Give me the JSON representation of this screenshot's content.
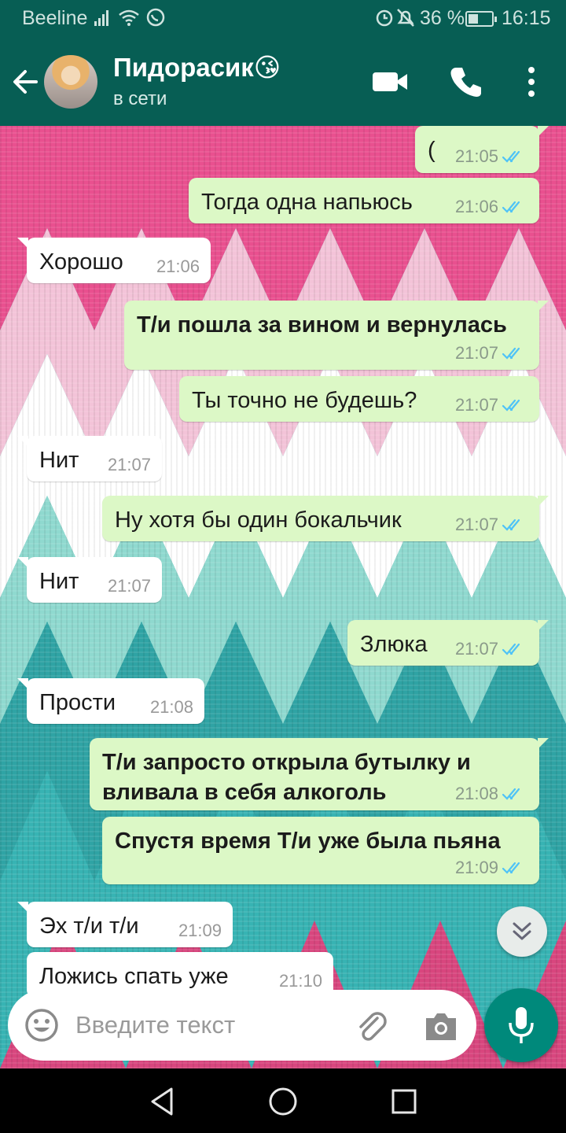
{
  "status_bar": {
    "carrier": "Beeline",
    "battery": "36 %",
    "time": "16:15"
  },
  "header": {
    "contact_name": "Пидорасик😘",
    "contact_status": "в сети"
  },
  "messages": [
    {
      "dir": "out",
      "text": "(",
      "time": "21:05",
      "bold": false
    },
    {
      "dir": "out",
      "text": "Тогда одна напьюсь",
      "time": "21:06",
      "bold": false
    },
    {
      "dir": "in",
      "text": "Хорошо",
      "time": "21:06",
      "bold": false
    },
    {
      "dir": "out",
      "text": "Т/и пошла за вином и вернулась",
      "time": "21:07",
      "bold": true
    },
    {
      "dir": "out",
      "text": "Ты точно не будешь?",
      "time": "21:07",
      "bold": false
    },
    {
      "dir": "in",
      "text": "Нит",
      "time": "21:07",
      "bold": false
    },
    {
      "dir": "out",
      "text": "Ну хотя бы один бокальчик",
      "time": "21:07",
      "bold": false
    },
    {
      "dir": "in",
      "text": "Нит",
      "time": "21:07",
      "bold": false
    },
    {
      "dir": "out",
      "text": "Злюка",
      "time": "21:07",
      "bold": false
    },
    {
      "dir": "in",
      "text": "Прости",
      "time": "21:08",
      "bold": false
    },
    {
      "dir": "out",
      "text_lines": [
        "Т/и запросто открыла бутылку и",
        "вливала в себя алкоголь"
      ],
      "time": "21:08",
      "bold": true
    },
    {
      "dir": "out",
      "text": "Спустя время Т/и уже была пьяна",
      "time": "21:09",
      "bold": true
    },
    {
      "dir": "in",
      "text": "Эх т/и т/и",
      "time": "21:09",
      "bold": false
    },
    {
      "dir": "in",
      "text": "Ложись спать уже",
      "time": "21:10",
      "bold": false
    }
  ],
  "input": {
    "placeholder": "Введите текст"
  },
  "colors": {
    "header": "#075e54",
    "outgoing_bubble": "#dcf8c6",
    "incoming_bubble": "#ffffff",
    "read_ticks": "#4fc3f7",
    "mic_button": "#00897b"
  }
}
